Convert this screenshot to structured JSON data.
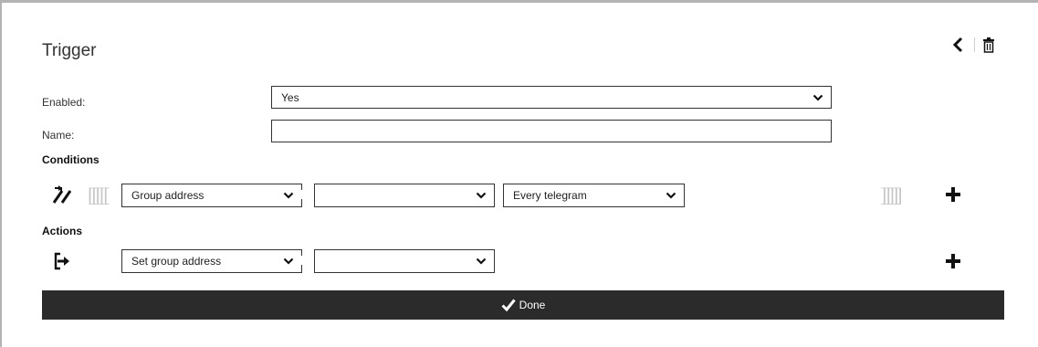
{
  "header": {
    "title": "Trigger"
  },
  "form": {
    "enabled_label": "Enabled:",
    "enabled_value": "Yes",
    "name_label": "Name:",
    "name_value": ""
  },
  "conditions": {
    "heading": "Conditions",
    "left_bracket": "[[[[[",
    "right_bracket": "]]]]]",
    "type_value": "Group address",
    "address_value": "",
    "filter_value": "Every telegram"
  },
  "actions": {
    "heading": "Actions",
    "type_value": "Set group address",
    "address_value": ""
  },
  "footer": {
    "done_label": "Done"
  },
  "icons": {
    "back": "chevron-left-icon",
    "delete": "trash-icon",
    "condition": "trigger-arrow-icon",
    "action": "sign-in-icon",
    "add": "plus-icon",
    "done": "checkmark-icon"
  }
}
